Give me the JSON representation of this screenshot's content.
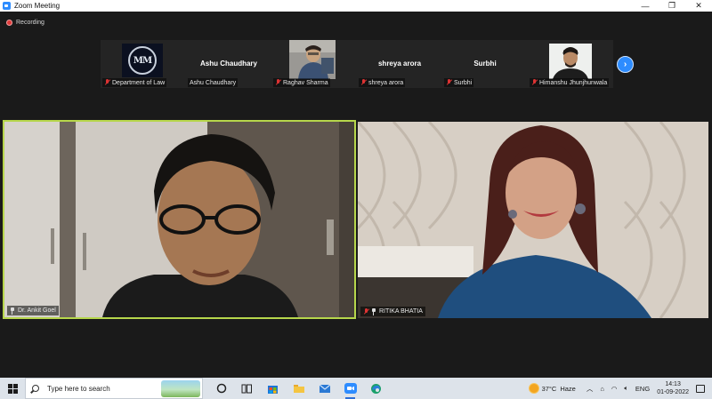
{
  "window": {
    "title": "Zoom Meeting",
    "controls": {
      "minimize": "—",
      "maximize": "❐",
      "close": "✕"
    }
  },
  "recording": {
    "label": "Recording",
    "color": "#e03a3a"
  },
  "participants_strip": [
    {
      "display": "logo",
      "label": "Department of Law",
      "muted": true
    },
    {
      "display": "name",
      "name_display": "Ashu Chaudhary",
      "label": "Ashu Chaudhary",
      "muted": false
    },
    {
      "display": "photo",
      "label": "Raghav Sharma",
      "muted": true
    },
    {
      "display": "name",
      "name_display": "shreya arora",
      "label": "shreya arora",
      "muted": true
    },
    {
      "display": "name",
      "name_display": "Surbhi",
      "label": "Surbhi",
      "muted": true
    },
    {
      "display": "photo",
      "label": "Himanshu Jhunjhunwala",
      "muted": true
    }
  ],
  "strip_next_icon": "chevron-right-icon",
  "main_videos": [
    {
      "label": "Dr. Ankit Goel",
      "active_speaker": true,
      "pinned": true
    },
    {
      "label": "RITIKA BHATIA",
      "active_speaker": false,
      "pinned": true,
      "muted": true
    }
  ],
  "taskbar": {
    "search_placeholder": "Type here to search",
    "weather": {
      "temp": "37°C",
      "condition": "Haze"
    },
    "language": "ENG",
    "time": "14:13",
    "date": "01-09-2022"
  },
  "colors": {
    "accent": "#2d8cff",
    "active_speaker_border": "#b6d64b",
    "muted_mic": "#dd3333"
  }
}
